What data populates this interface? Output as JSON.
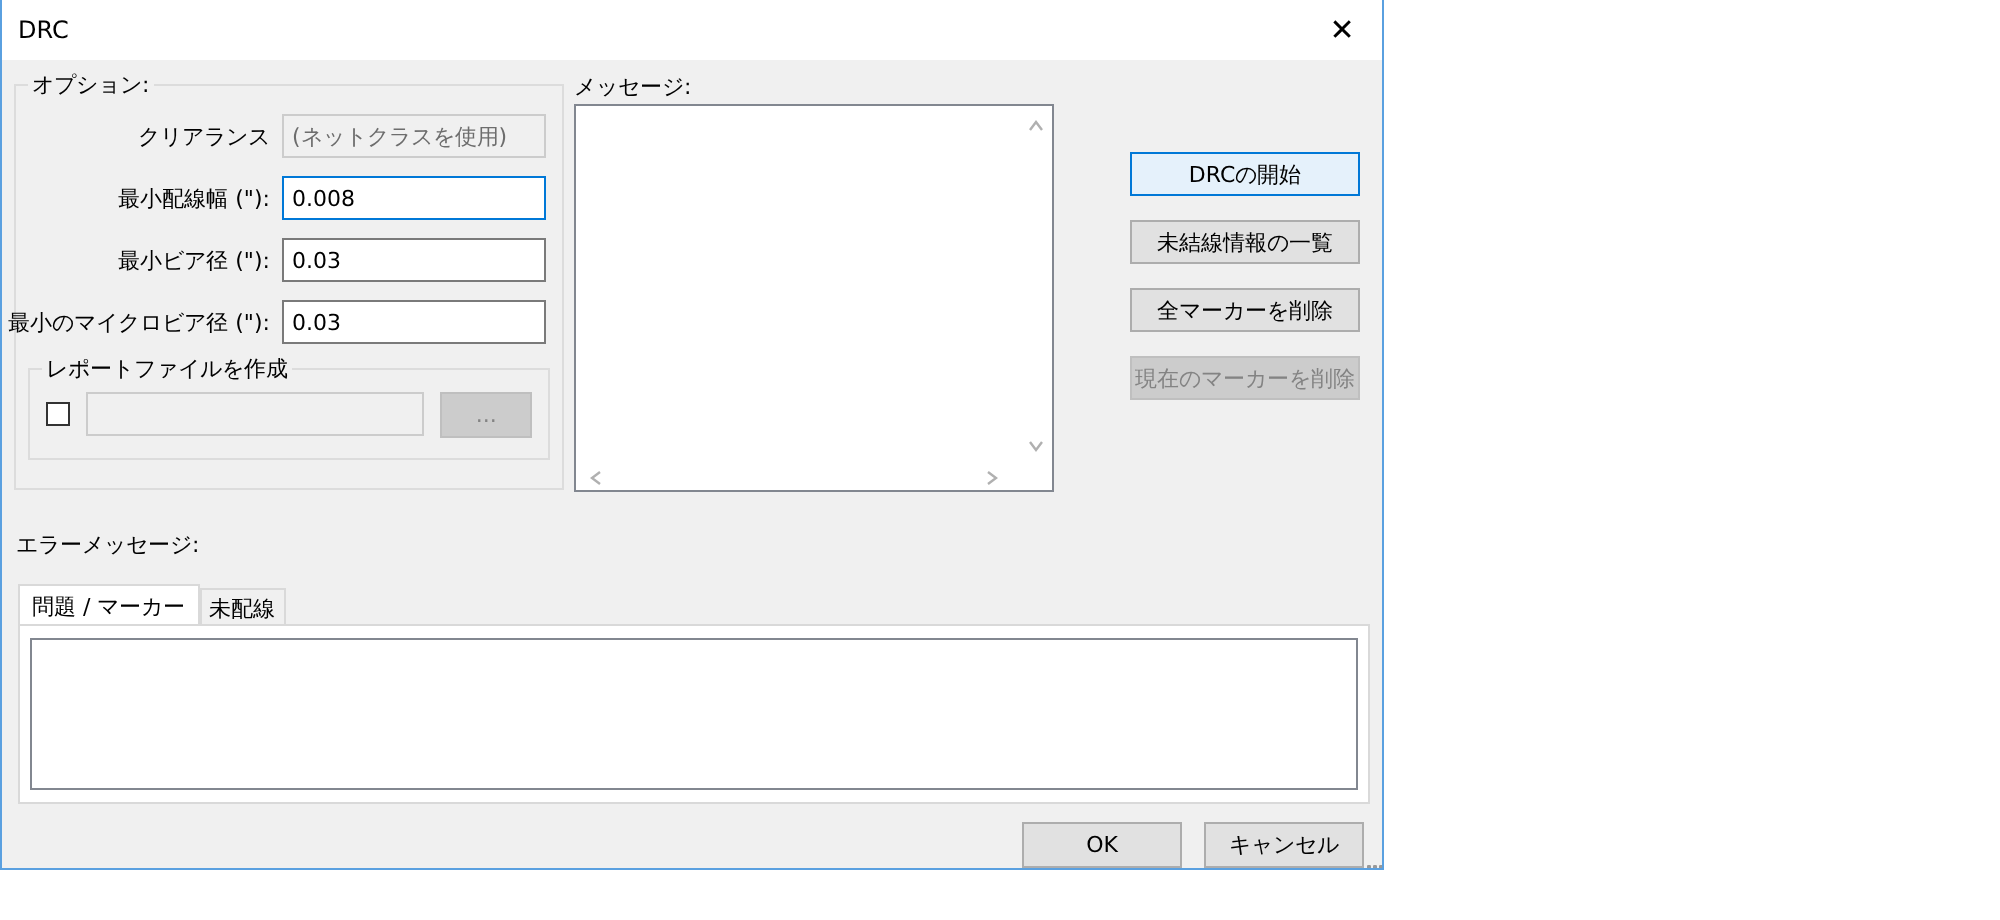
{
  "window": {
    "title": "DRC",
    "close": "✕"
  },
  "options": {
    "legend": "オプション:",
    "fields": [
      {
        "label": "クリアランス",
        "value": "(ネットクラスを使用)",
        "disabled": true,
        "focused": false
      },
      {
        "label": "最小配線幅 (\"):",
        "value": "0.008",
        "disabled": false,
        "focused": true
      },
      {
        "label": "最小ビア径 (\"):",
        "value": "0.03",
        "disabled": false,
        "focused": false
      },
      {
        "label": "最小のマイクロビア径 (\"):",
        "value": "0.03",
        "disabled": false,
        "focused": false
      }
    ],
    "report": {
      "legend": "レポートファイルを作成",
      "checked": false,
      "browse": "...",
      "browse_disabled": true
    }
  },
  "messages": {
    "label": "メッセージ:"
  },
  "actions": [
    {
      "label": "DRCの開始",
      "disabled": false,
      "default": true
    },
    {
      "label": "未結線情報の一覧",
      "disabled": false,
      "default": false
    },
    {
      "label": "全マーカーを削除",
      "disabled": false,
      "default": false
    },
    {
      "label": "現在のマーカーを削除",
      "disabled": true,
      "default": false
    }
  ],
  "errors": {
    "label": "エラーメッセージ:",
    "tabs": [
      {
        "label": "問題 / マーカー",
        "selected": true
      },
      {
        "label": "未配線",
        "selected": false
      }
    ]
  },
  "footer": [
    {
      "label": "OK",
      "default": false
    },
    {
      "label": "キャンセル",
      "default": false
    }
  ]
}
